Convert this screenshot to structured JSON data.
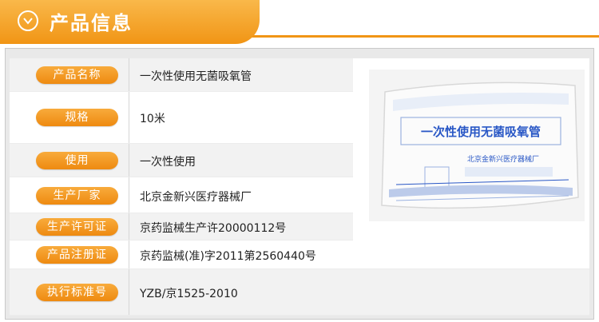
{
  "header": {
    "title": "产品信息",
    "icon": "check-circle-icon"
  },
  "info": [
    {
      "label": "产品名称",
      "value": "一次性使用无菌吸氧管"
    },
    {
      "label": "规格",
      "value": "10米"
    },
    {
      "label": "使用",
      "value": "一次性使用"
    },
    {
      "label": "生产厂家",
      "value": "北京金新兴医疗器械厂"
    },
    {
      "label": "生产许可证",
      "value": "京药监械生产许20000112号"
    },
    {
      "label": "产品注册证",
      "value": "京药监械(准)字2011第2560440号"
    },
    {
      "label": "执行标准号",
      "value": "YZB/京1525-2010"
    }
  ],
  "product_image": {
    "title": "一次性使用无菌吸氧管",
    "maker": "北京金新兴医疗器械厂",
    "colors": {
      "accent": "#f19515",
      "label_blue": "#2a58c6"
    }
  }
}
